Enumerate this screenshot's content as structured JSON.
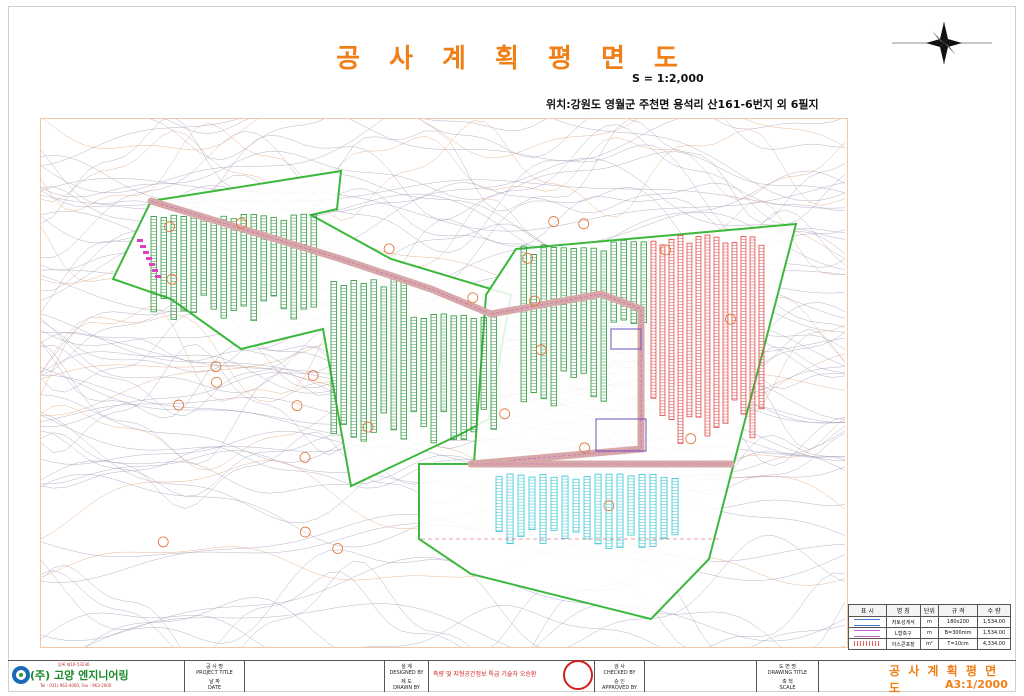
{
  "title": "공 사 계 획 평 면 도",
  "scale_text": "S = 1:2,000",
  "location": "위치:강원도 영월군 주천면 용석리 산161-6번지 외 6필지",
  "legend": {
    "headers": [
      "표 시",
      "명 칭",
      "단위",
      "규 격",
      "수 량"
    ],
    "rows": [
      {
        "name": "저토성게석",
        "unit": "m",
        "spec": "180x200",
        "qty": "1,534.00",
        "color": "#4a7ad0"
      },
      {
        "name": "L형측구",
        "unit": "m",
        "spec": "B=300mm",
        "qty": "1,534.00",
        "color": "#c060c0"
      },
      {
        "name": "아스콘포장",
        "unit": "m²",
        "spec": "T=10cm",
        "qty": "4,334.00",
        "color": "#e06060"
      }
    ]
  },
  "title_block": {
    "company": "(주) 고양 엔지니어링",
    "company_small": "등록 제10-53236",
    "company_tel": "Tel : 031) 963-4000,  Fax : 963-2000",
    "project_title_ko": "공 사 명",
    "project_title_en": "PROJECT TITLE",
    "date_ko": "날 짜",
    "date_en": "DATE",
    "designed_ko": "설 계",
    "designed_en": "DESIGNED BY",
    "drawn_ko": "제 도",
    "drawn_en": "DRAWN BY",
    "cert_text": "측량 및 지형공간정보 특급 기술자 오승환",
    "checked_ko": "검 사",
    "checked_en": "CHECKED BY",
    "approved_ko": "승 인",
    "approved_en": "APPROVED BY",
    "drawing_title_ko": "도 면 명",
    "drawing_title_en": "DRAWING TITLE",
    "scale_ko": "축 척",
    "scale_en": "SCALE",
    "drawing_title": "공 사 계 획 평 면 도",
    "drawing_scale": "A3:1/2000"
  },
  "colors": {
    "accent": "#f07f18",
    "boundary": "#3cb83c",
    "panel_green": "#2e9a3e",
    "panel_red": "#e04a4a",
    "panel_cyan": "#38c8d8",
    "road": "#d8a8a8",
    "contour": "#a09ab4",
    "contour_orange": "#e0a070"
  }
}
